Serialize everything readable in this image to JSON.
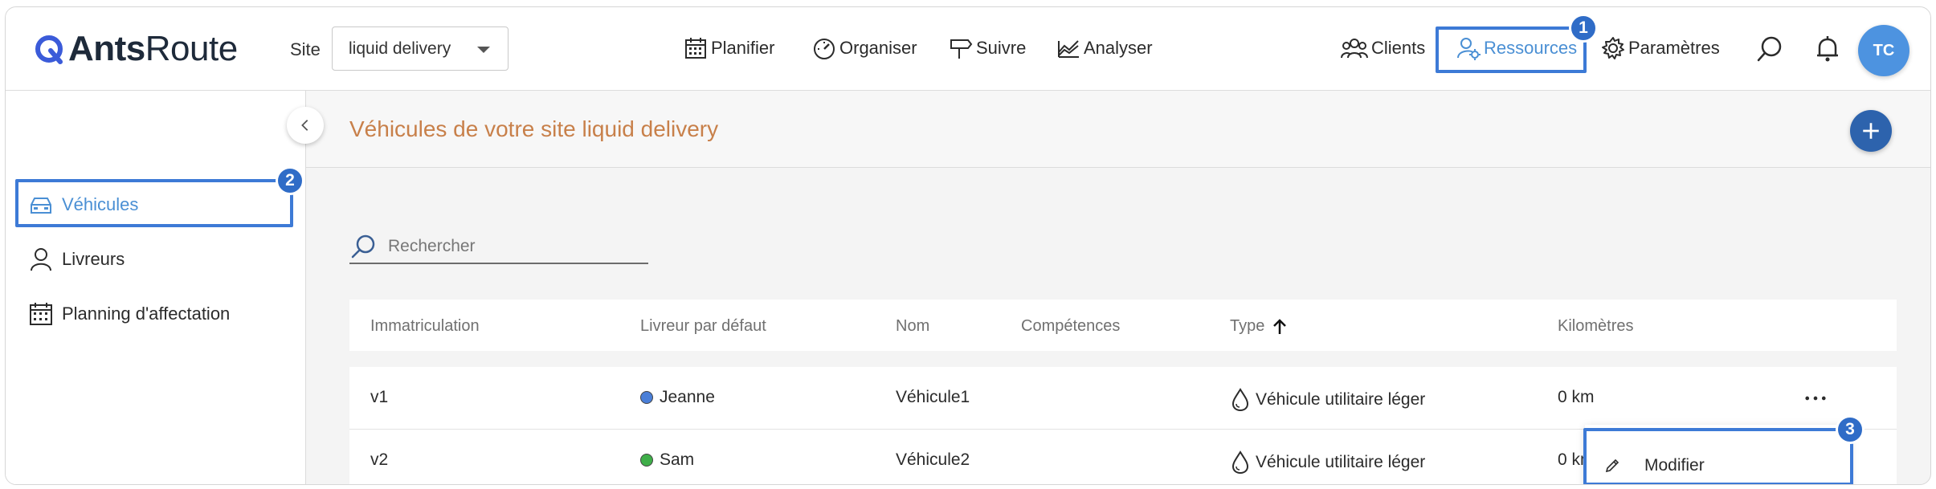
{
  "header": {
    "logo_bold": "Ants",
    "logo_light": "Route",
    "site_label": "Site",
    "site_value": "liquid delivery",
    "nav": {
      "planifier": "Planifier",
      "organiser": "Organiser",
      "suivre": "Suivre",
      "analyser": "Analyser",
      "clients": "Clients",
      "ressources": "Ressources",
      "parametres": "Paramètres"
    },
    "avatar_initials": "TC"
  },
  "badges": {
    "one": "1",
    "two": "2",
    "three": "3"
  },
  "sidebar": {
    "items": [
      {
        "label": "Véhicules",
        "icon": "car-icon",
        "active": true
      },
      {
        "label": "Livreurs",
        "icon": "person-icon",
        "active": false
      },
      {
        "label": "Planning d'affectation",
        "icon": "calendar-icon",
        "active": false
      }
    ]
  },
  "main": {
    "title": "Véhicules de votre site liquid delivery",
    "search_placeholder": "Rechercher",
    "columns": [
      "Immatriculation",
      "Livreur par défaut",
      "Nom",
      "Compétences",
      "Type",
      "Kilomètres"
    ],
    "rows": [
      {
        "immatriculation": "v1",
        "livreur": "Jeanne",
        "livreur_color": "#4a7fd8",
        "nom": "Véhicule1",
        "competences": "",
        "type": "Véhicule utilitaire léger",
        "km": "0 km"
      },
      {
        "immatriculation": "v2",
        "livreur": "Sam",
        "livreur_color": "#3fae49",
        "nom": "Véhicule2",
        "competences": "",
        "type": "Véhicule utilitaire léger",
        "km": "0 km"
      }
    ],
    "context_menu": {
      "modifier": "Modifier"
    }
  },
  "colors": {
    "accent": "#4a8fd4",
    "highlight": "#3d7ad6",
    "title": "#c8804a",
    "add_button": "#2d63ad"
  }
}
